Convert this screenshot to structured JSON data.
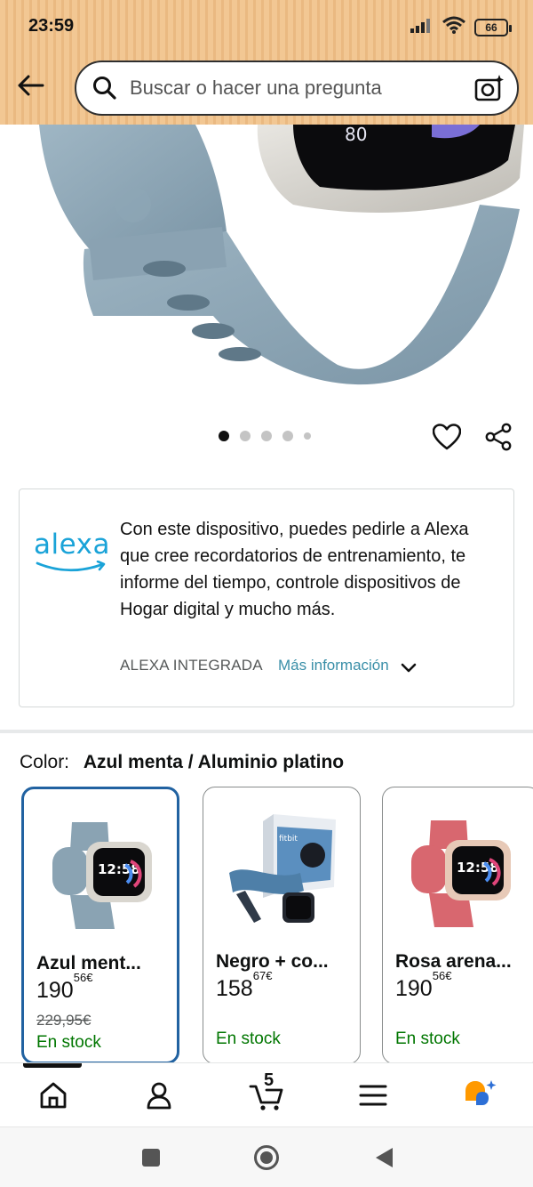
{
  "status_bar": {
    "time": "23:59",
    "battery": "66",
    "icons": [
      "signal-icon",
      "wifi-icon",
      "battery-icon"
    ]
  },
  "header": {
    "back_icon": "arrow-left-icon",
    "search_placeholder": "Buscar o hacer una pregunta",
    "search_icon": "search-icon",
    "camera_icon": "camera-search-icon"
  },
  "carousel": {
    "total_images": 5,
    "active_index": 0
  },
  "actions": {
    "wishlist_icon": "heart-icon",
    "share_icon": "share-icon"
  },
  "alexa_card": {
    "logo_text": "alexa",
    "description": "Con este dispositivo, puedes pedirle a Alexa que cree recordatorios de entrenamiento, te informe del tiempo, controle dispositivos de Hogar digital y mucho más.",
    "tag": "ALEXA INTEGRADA",
    "more_link": "Más información",
    "colors": {
      "alexa_blue": "#1aa3d8",
      "link": "#3a8fa8"
    }
  },
  "color_selection": {
    "label": "Color:",
    "selected_value": "Azul menta / Aluminio platino",
    "options": [
      {
        "name": "Azul ment...",
        "price_whole": "190",
        "price_fraction": "56",
        "currency": "€",
        "old_price": "229,95€",
        "stock": "En stock",
        "selected": true
      },
      {
        "name": "Negro + co...",
        "price_whole": "158",
        "price_fraction": "67",
        "currency": "€",
        "old_price": "",
        "stock": "En stock",
        "selected": false
      },
      {
        "name": "Rosa arena...",
        "price_whole": "190",
        "price_fraction": "56",
        "currency": "€",
        "old_price": "",
        "stock": "En stock",
        "selected": false
      }
    ],
    "colors": {
      "selected_border": "#2162a1",
      "in_stock": "#007600"
    }
  },
  "bottom_nav": {
    "items": [
      "home-icon",
      "account-icon",
      "cart-icon",
      "menu-icon",
      "rufus-ai-icon"
    ],
    "cart_count": "5"
  },
  "system_nav": {
    "items": [
      "recents-icon",
      "home-circle-icon",
      "back-triangle-icon"
    ]
  },
  "theme": {
    "header_bg": "#f2c793",
    "accent_orange": "#ff9900"
  }
}
